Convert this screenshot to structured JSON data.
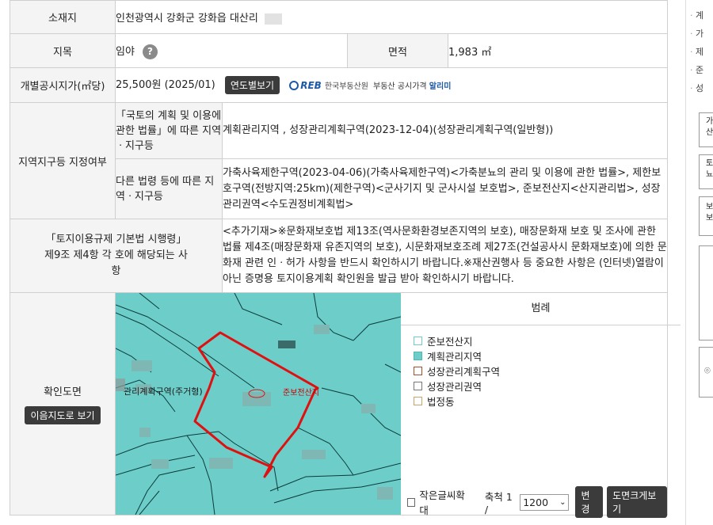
{
  "rows": {
    "location": {
      "label": "소재지",
      "value": "인천광역시 강화군 강화읍 대산리"
    },
    "category": {
      "label": "지목",
      "value": "임야",
      "help_icon": "question-icon"
    },
    "area": {
      "label": "면적",
      "value": "1,983 ㎡"
    },
    "price": {
      "label": "개별공시지가(㎡당)",
      "value": "25,500원 (2025/01)",
      "button": "연도별보기",
      "reb_logo": "REB",
      "reb_org": "한국부동산원",
      "reb_service": "부동산 공시가격",
      "reb_service_bold": "알리미"
    },
    "zoning": {
      "label": "지역지구등 지정여부",
      "sub1_label": "「국토의 계획 및 이용에 관한 법률」에 따른 지역ㆍ지구등",
      "sub1_value": "계획관리지역 , 성장관리계획구역(2023-12-04)(성장관리계획구역(일반형))",
      "sub2_label": "다른 법령 등에 따른 지역ㆍ지구등",
      "sub2_value": "가축사육제한구역(2023-04-06)(가축사육제한구역)<가축분뇨의 관리 및 이용에 관한 법률>, 제한보호구역(전방지역:25km)(제한구역)<군사기지 및 군사시설 보호법>, 준보전산지<산지관리법>, 성장관리권역<수도권정비계획법>"
    },
    "regulation": {
      "label": "「토지이용규제 기본법 시행령」 제9조 제4항 각 호에 해당되는 사항",
      "value": "<추가기재>※문화재보호법 제13조(역사문화환경보존지역의 보호), 매장문화재 보호 및 조사에 관한 법률 제4조(매장문화재 유존지역의 보호), 시문화재보호조례 제27조(건설공사시 문화재보호)에 의한 문화재 관련 인ㆍ허가 사항을 반드시 확인하시기 바랍니다.※재산권행사 등 중요한 사항은 (인터넷)열람이 아닌 증명용 토지이용계획 확인원을 발급 받아 확인하시기 바랍니다."
    },
    "map": {
      "label": "확인도면",
      "button": "이음지도로 보기",
      "map_label_zone": "관리계획구역(주거형)",
      "map_label_forest": "준보전산지"
    }
  },
  "legend": {
    "title": "범례",
    "items": [
      {
        "label": "준보전산지",
        "border": "#6dcdc9",
        "fill": "#ffffff"
      },
      {
        "label": "계획관리지역",
        "border": "#4fb8b3",
        "fill": "#6dcdc9"
      },
      {
        "label": "성장관리계획구역",
        "border": "#a0522d",
        "fill": "#ffffff"
      },
      {
        "label": "성장관리권역",
        "border": "#777777",
        "fill": "#ffffff"
      },
      {
        "label": "법정동",
        "border": "#c8a36a",
        "fill": "#ffffff"
      }
    ]
  },
  "controls": {
    "small_text": "작은글씨확대",
    "scale_label": "축척 1 /",
    "scale_value": "1200",
    "change_button": "변경",
    "large_map_button": "도면크게보기"
  },
  "sidebar": {
    "items": [
      "계",
      "가",
      "제",
      "준",
      "성"
    ],
    "boxes": [
      "가\n산",
      "토\n뇨",
      "보\n보"
    ]
  },
  "colors": {
    "map_fill": "#6dcdc9",
    "parcel_outline": "#e01010",
    "header_bg": "#f4f4f4"
  }
}
